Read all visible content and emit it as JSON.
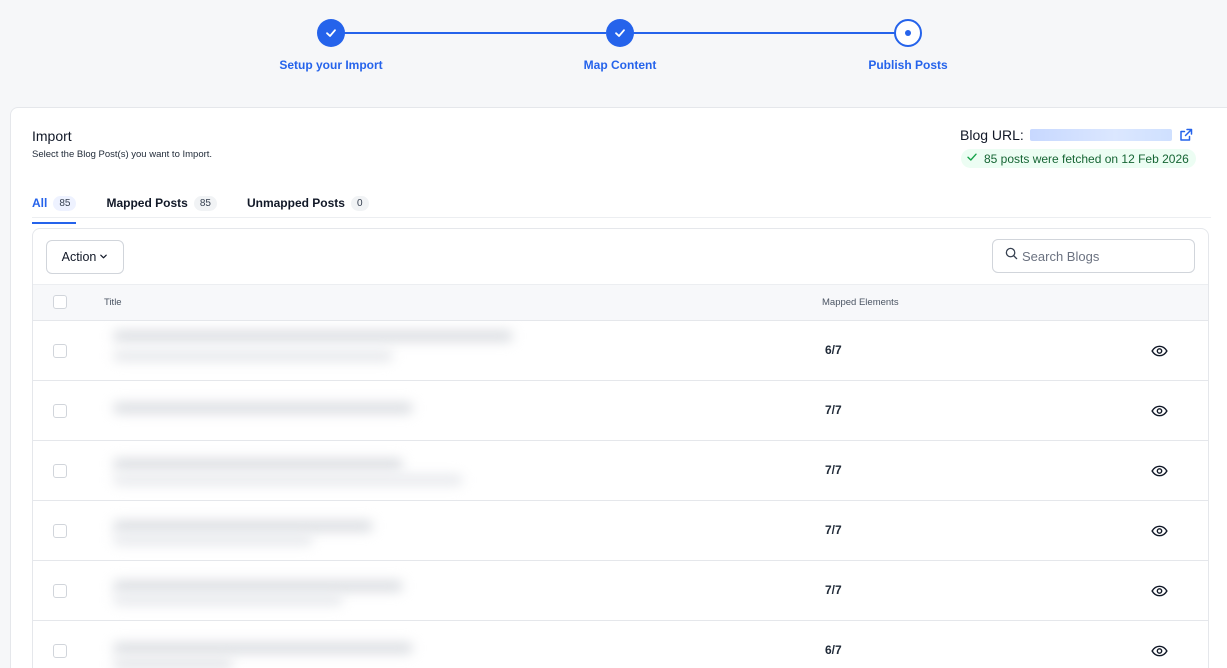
{
  "stepper": {
    "steps": [
      {
        "label": "Setup your Import",
        "state": "done"
      },
      {
        "label": "Map Content",
        "state": "done"
      },
      {
        "label": "Publish Posts",
        "state": "current"
      }
    ]
  },
  "import": {
    "title": "Import",
    "subtitle": "Select the Blog Post(s) you want to Import.",
    "blog_url_label": "Blog URL:",
    "fetched_text": "85 posts were fetched on 12 Feb 2026"
  },
  "tabs": [
    {
      "label": "All",
      "count": "85",
      "active": true
    },
    {
      "label": "Mapped Posts",
      "count": "85",
      "active": false
    },
    {
      "label": "Unmapped Posts",
      "count": "0",
      "active": false
    }
  ],
  "toolbar": {
    "action_label": "Action",
    "search_placeholder": "Search Blogs"
  },
  "table": {
    "columns": {
      "title": "Title",
      "mapped": "Mapped Elements"
    },
    "rows": [
      {
        "mapped": "6/7"
      },
      {
        "mapped": "7/7"
      },
      {
        "mapped": "7/7"
      },
      {
        "mapped": "7/7"
      },
      {
        "mapped": "7/7"
      },
      {
        "mapped": "6/7"
      }
    ]
  },
  "colors": {
    "accent": "#2563eb",
    "success_bg": "#ecfdf3",
    "success_text": "#166534"
  },
  "icons": {
    "step_done": "check-icon",
    "step_current": "dot-icon",
    "external": "external-link-icon",
    "fetched": "check-icon",
    "search": "search-icon",
    "dropdown": "chevron-down-icon",
    "view": "eye-icon"
  }
}
